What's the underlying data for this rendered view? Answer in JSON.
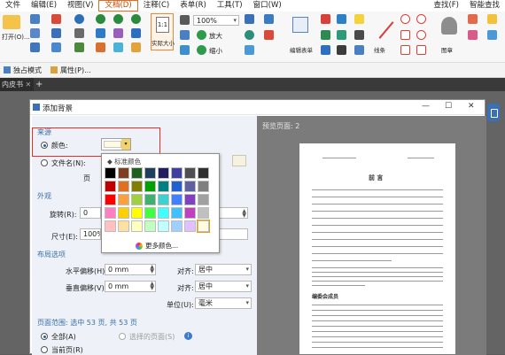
{
  "menu": {
    "items": [
      "文件",
      "编辑(E)",
      "视图(V)",
      "文档(D)",
      "注释(C)",
      "表单(R)",
      "工具(T)",
      "窗口(W)"
    ],
    "active_index": 3,
    "right_items": [
      "查找(F)",
      "智能查找"
    ]
  },
  "toolbar": {
    "open_label": "打开(O)...",
    "zoom_value": "100%",
    "actual_size_label": "实际大小",
    "zoom_in_label": "放大",
    "zoom_out_label": "缩小",
    "edit_content_label": "编辑表单",
    "shapes_label": "线条",
    "stamp_label": "图章",
    "mode_label": "独占模式",
    "properties_label": "属性(P)..."
  },
  "tabs": {
    "doc_tab": "内皮书"
  },
  "dialog": {
    "title": "添加背景",
    "source_section": "来源",
    "color_label": "颜色:",
    "file_label": "文件名(N):",
    "page_label": "页",
    "appearance_section": "外观",
    "rotation_label": "旋转(R):",
    "rotation_value": "0",
    "size_label": "尺寸(E):",
    "size_value": "100%",
    "layout_section": "布局选项",
    "h_offset_label": "水平偏移(H):",
    "h_offset_value": "0 mm",
    "v_offset_label": "垂直偏移(V):",
    "v_offset_value": "0 mm",
    "align1_label": "对齐:",
    "align1_value": "居中",
    "align2_label": "对齐:",
    "align2_value": "居中",
    "unit_label": "单位(U):",
    "unit_value": "毫米",
    "page_range_section": "页面范围: 选中 53 页, 共 53 页",
    "all_pages_label": "全部(A)",
    "selected_pages_label": "选择的页面(S)",
    "current_page_label": "当前页(R)",
    "preview_label": "预览页面: 2"
  },
  "color_popup": {
    "header": "标准颜色",
    "more_label": "更多颜色...",
    "selected_index": 39,
    "swatches": [
      "#000000",
      "#7f3f1f",
      "#1f5f1f",
      "#1f3f5f",
      "#1f1f5f",
      "#3f3f9f",
      "#4f4f4f",
      "#2f2f2f",
      "#c00000",
      "#e07020",
      "#808000",
      "#00a000",
      "#008080",
      "#2060d0",
      "#6060a0",
      "#7f7f7f",
      "#ff0000",
      "#ffa040",
      "#a0d040",
      "#40b070",
      "#40d0d0",
      "#4080ff",
      "#8040c0",
      "#a0a0a0",
      "#ff80c0",
      "#ffd000",
      "#ffff00",
      "#40ff40",
      "#40ffff",
      "#40c0ff",
      "#c040c0",
      "#c0c0c0",
      "#ffc0c0",
      "#ffe0a0",
      "#ffffc0",
      "#c0ffc0",
      "#c0ffff",
      "#a0d0ff",
      "#e0c0ff",
      "#fffbe3"
    ]
  },
  "preview_page": {
    "heading": "前 言",
    "subheading": "编委会成员"
  }
}
